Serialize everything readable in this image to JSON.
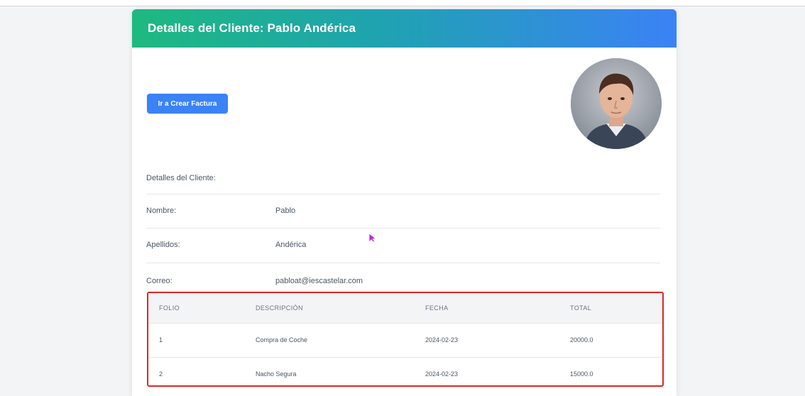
{
  "header": {
    "title": "Detalles del Cliente: Pablo Andérica"
  },
  "actions": {
    "create_invoice_label": "Ir a Crear Factura"
  },
  "client": {
    "section_label": "Detalles del Cliente:",
    "fields": [
      {
        "label": "Nombre:",
        "value": "Pablo"
      },
      {
        "label": "Apellidos:",
        "value": "Andérica"
      },
      {
        "label": "Correo:",
        "value": "pabloat@iescastelar.com"
      }
    ]
  },
  "invoices": {
    "columns": [
      "FOLIO",
      "DESCRIPCIÓN",
      "FECHA",
      "TOTAL"
    ],
    "rows": [
      [
        "1",
        "Compra de Coche",
        "2024-02-23",
        "20000.0"
      ],
      [
        "2",
        "Nacho Segura",
        "2024-02-23",
        "15000.0"
      ]
    ]
  },
  "colors": {
    "header_gradient_start": "#1eb980",
    "header_gradient_end": "#3b82f6",
    "button": "#3b82f6",
    "table_highlight_border": "#dc2626",
    "cursor": "#c026d3"
  },
  "icons": {
    "cursor": "mouse-pointer-icon",
    "avatar": "user-avatar"
  }
}
